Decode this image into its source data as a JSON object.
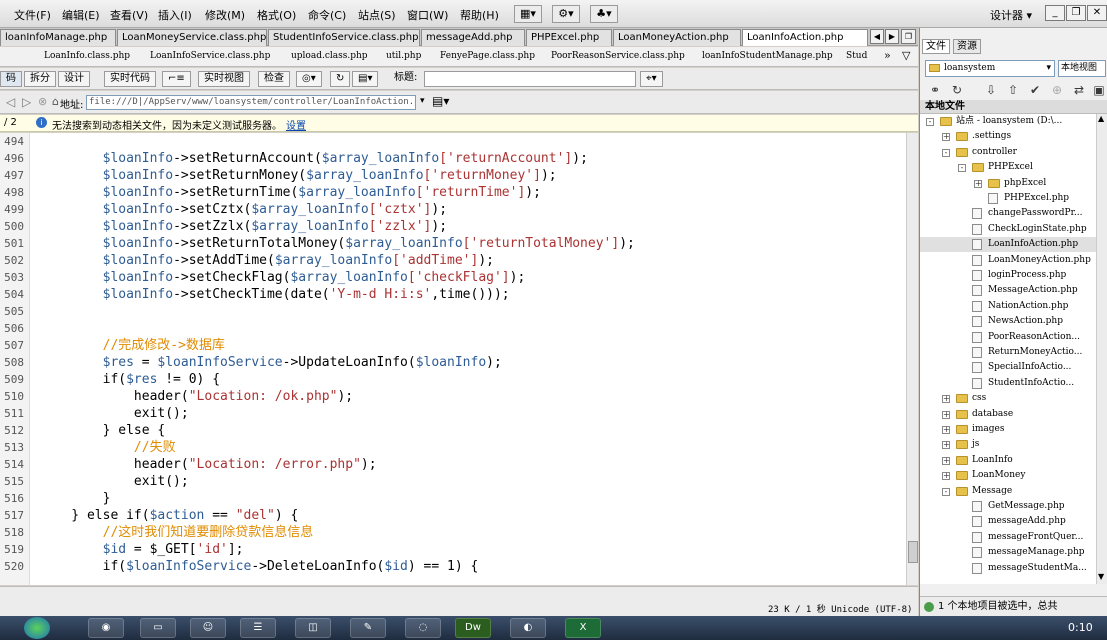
{
  "menus": [
    "文件(F)",
    "编辑(E)",
    "查看(V)",
    "插入(I)",
    "修改(M)",
    "格式(O)",
    "命令(C)",
    "站点(S)",
    "窗口(W)",
    "帮助(H)"
  ],
  "workspace": "设计器",
  "file_tabs": [
    {
      "label": "loanInfoManage.php"
    },
    {
      "label": "LoanMoneyService.class.php"
    },
    {
      "label": "StudentInfoService.class.php"
    },
    {
      "label": "messageAdd.php"
    },
    {
      "label": "PHPExcel.php"
    },
    {
      "label": "LoanMoneyAction.php"
    },
    {
      "label": "LoanInfoAction.php"
    }
  ],
  "related_files": [
    "LoanInfo.class.php",
    "LoanInfoService.class.php",
    "upload.class.php",
    "util.php",
    "FenyePage.class.php",
    "PoorReasonService.class.php",
    "loanInfoStudentManage.php",
    "Stud"
  ],
  "doc_toolbar": {
    "code": "码",
    "split": "拆分",
    "design": "设计",
    "live_code": "实时代码",
    "live_view": "实时视图",
    "inspect": "检查",
    "title_label": "标题:"
  },
  "address": {
    "label": "地址:",
    "value": "file:///D|/AppServ/www/loansystem/controller/LoanInfoAction.php"
  },
  "infobar": {
    "page": "/ 2",
    "message": "无法搜索到动态相关文件，因为未定义测试服务器。",
    "link": "设置"
  },
  "code_lines": [
    {
      "n": "494",
      "t": [
        {
          "c": "",
          "s": ""
        }
      ]
    },
    {
      "n": "496",
      "t": [
        {
          "c": "v",
          "s": "        $loanInfo"
        },
        {
          "c": "",
          "s": "->setReturnAccount("
        },
        {
          "c": "v",
          "s": "$array_loanInfo"
        },
        {
          "c": "s",
          "s": "['returnAccount']"
        },
        {
          "c": "",
          "s": ");"
        }
      ]
    },
    {
      "n": "497",
      "t": [
        {
          "c": "v",
          "s": "        $loanInfo"
        },
        {
          "c": "",
          "s": "->setReturnMoney("
        },
        {
          "c": "v",
          "s": "$array_loanInfo"
        },
        {
          "c": "s",
          "s": "['returnMoney']"
        },
        {
          "c": "",
          "s": ");"
        }
      ]
    },
    {
      "n": "498",
      "t": [
        {
          "c": "v",
          "s": "        $loanInfo"
        },
        {
          "c": "",
          "s": "->setReturnTime("
        },
        {
          "c": "v",
          "s": "$array_loanInfo"
        },
        {
          "c": "s",
          "s": "['returnTime']"
        },
        {
          "c": "",
          "s": ");"
        }
      ]
    },
    {
      "n": "499",
      "t": [
        {
          "c": "v",
          "s": "        $loanInfo"
        },
        {
          "c": "",
          "s": "->setCztx("
        },
        {
          "c": "v",
          "s": "$array_loanInfo"
        },
        {
          "c": "s",
          "s": "['cztx']"
        },
        {
          "c": "",
          "s": ");"
        }
      ]
    },
    {
      "n": "500",
      "t": [
        {
          "c": "v",
          "s": "        $loanInfo"
        },
        {
          "c": "",
          "s": "->setZzlx("
        },
        {
          "c": "v",
          "s": "$array_loanInfo"
        },
        {
          "c": "s",
          "s": "['zzlx']"
        },
        {
          "c": "",
          "s": ");"
        }
      ]
    },
    {
      "n": "501",
      "t": [
        {
          "c": "v",
          "s": "        $loanInfo"
        },
        {
          "c": "",
          "s": "->setReturnTotalMoney("
        },
        {
          "c": "v",
          "s": "$array_loanInfo"
        },
        {
          "c": "s",
          "s": "['returnTotalMoney']"
        },
        {
          "c": "",
          "s": ");"
        }
      ]
    },
    {
      "n": "502",
      "t": [
        {
          "c": "v",
          "s": "        $loanInfo"
        },
        {
          "c": "",
          "s": "->setAddTime("
        },
        {
          "c": "v",
          "s": "$array_loanInfo"
        },
        {
          "c": "s",
          "s": "['addTime']"
        },
        {
          "c": "",
          "s": ");"
        }
      ]
    },
    {
      "n": "503",
      "t": [
        {
          "c": "v",
          "s": "        $loanInfo"
        },
        {
          "c": "",
          "s": "->setCheckFlag("
        },
        {
          "c": "v",
          "s": "$array_loanInfo"
        },
        {
          "c": "s",
          "s": "['checkFlag']"
        },
        {
          "c": "",
          "s": ");"
        }
      ]
    },
    {
      "n": "504",
      "t": [
        {
          "c": "v",
          "s": "        $loanInfo"
        },
        {
          "c": "",
          "s": "->setCheckTime(date("
        },
        {
          "c": "s",
          "s": "'Y-m-d H:i:s'"
        },
        {
          "c": "",
          "s": ",time()));"
        }
      ]
    },
    {
      "n": "505",
      "t": [
        {
          "c": "",
          "s": ""
        }
      ]
    },
    {
      "n": "506",
      "t": [
        {
          "c": "",
          "s": ""
        }
      ]
    },
    {
      "n": "507",
      "t": [
        {
          "c": "m",
          "s": "        //完成修改->数据库"
        }
      ]
    },
    {
      "n": "508",
      "t": [
        {
          "c": "v",
          "s": "        $res"
        },
        {
          "c": "",
          "s": " = "
        },
        {
          "c": "v",
          "s": "$loanInfoService"
        },
        {
          "c": "",
          "s": "->UpdateLoanInfo("
        },
        {
          "c": "v",
          "s": "$loanInfo"
        },
        {
          "c": "",
          "s": ");"
        }
      ]
    },
    {
      "n": "509",
      "t": [
        {
          "c": "",
          "s": "        if("
        },
        {
          "c": "v",
          "s": "$res"
        },
        {
          "c": "",
          "s": " != 0) {"
        }
      ]
    },
    {
      "n": "510",
      "t": [
        {
          "c": "",
          "s": "            header("
        },
        {
          "c": "s",
          "s": "\"Location: /ok.php\""
        },
        {
          "c": "",
          "s": ");"
        }
      ]
    },
    {
      "n": "511",
      "t": [
        {
          "c": "",
          "s": "            exit();"
        }
      ]
    },
    {
      "n": "512",
      "t": [
        {
          "c": "",
          "s": "        } else {"
        }
      ]
    },
    {
      "n": "513",
      "t": [
        {
          "c": "m",
          "s": "            //失败"
        }
      ]
    },
    {
      "n": "514",
      "t": [
        {
          "c": "",
          "s": "            header("
        },
        {
          "c": "s",
          "s": "\"Location: /error.php\""
        },
        {
          "c": "",
          "s": ");"
        }
      ]
    },
    {
      "n": "515",
      "t": [
        {
          "c": "",
          "s": "            exit();"
        }
      ]
    },
    {
      "n": "516",
      "t": [
        {
          "c": "",
          "s": "        }"
        }
      ]
    },
    {
      "n": "517",
      "t": [
        {
          "c": "",
          "s": "    } else if("
        },
        {
          "c": "v",
          "s": "$action"
        },
        {
          "c": "",
          "s": " == "
        },
        {
          "c": "s",
          "s": "\"del\""
        },
        {
          "c": "",
          "s": ") {"
        }
      ]
    },
    {
      "n": "518",
      "t": [
        {
          "c": "m",
          "s": "        //这时我们知道要删除贷款信息信息"
        }
      ]
    },
    {
      "n": "519",
      "t": [
        {
          "c": "v",
          "s": "        $id"
        },
        {
          "c": "",
          "s": " = $_GET["
        },
        {
          "c": "s",
          "s": "'id'"
        },
        {
          "c": "",
          "s": "];"
        }
      ]
    },
    {
      "n": "520",
      "t": [
        {
          "c": "",
          "s": "        if("
        },
        {
          "c": "v",
          "s": "$loanInfoService"
        },
        {
          "c": "",
          "s": "->DeleteLoanInfo("
        },
        {
          "c": "v",
          "s": "$id"
        },
        {
          "c": "",
          "s": ") == 1) {"
        }
      ]
    }
  ],
  "status": "23 K / 1 秒  Unicode (UTF-8)",
  "panel": {
    "tab_files": "文件",
    "tab_assets": "资源",
    "site": "loansystem",
    "view": "本地视图",
    "local_files": "本地文件",
    "status": "1 个本地项目被选中，总共"
  },
  "tree": [
    {
      "label": "站点 - loansystem (D:\\...",
      "depth": 0,
      "kind": "folder",
      "exp": "-"
    },
    {
      "label": ".settings",
      "depth": 1,
      "kind": "folder",
      "exp": "+"
    },
    {
      "label": "controller",
      "depth": 1,
      "kind": "folder",
      "exp": "-"
    },
    {
      "label": "PHPExcel",
      "depth": 2,
      "kind": "folder",
      "exp": "-"
    },
    {
      "label": "phpExcel",
      "depth": 3,
      "kind": "folder",
      "exp": "+"
    },
    {
      "label": "PHPExcel.php",
      "depth": 3,
      "kind": "php",
      "exp": ""
    },
    {
      "label": "changePasswordPr...",
      "depth": 2,
      "kind": "php",
      "exp": ""
    },
    {
      "label": "CheckLoginState.php",
      "depth": 2,
      "kind": "php",
      "exp": ""
    },
    {
      "label": "LoanInfoAction.php",
      "depth": 2,
      "kind": "php",
      "exp": "",
      "selected": true
    },
    {
      "label": "LoanMoneyAction.php",
      "depth": 2,
      "kind": "php",
      "exp": ""
    },
    {
      "label": "loginProcess.php",
      "depth": 2,
      "kind": "php",
      "exp": ""
    },
    {
      "label": "MessageAction.php",
      "depth": 2,
      "kind": "php",
      "exp": ""
    },
    {
      "label": "NationAction.php",
      "depth": 2,
      "kind": "php",
      "exp": ""
    },
    {
      "label": "NewsAction.php",
      "depth": 2,
      "kind": "php",
      "exp": ""
    },
    {
      "label": "PoorReasonAction...",
      "depth": 2,
      "kind": "php",
      "exp": ""
    },
    {
      "label": "ReturnMoneyActio...",
      "depth": 2,
      "kind": "php",
      "exp": ""
    },
    {
      "label": "SpecialInfoActio...",
      "depth": 2,
      "kind": "php",
      "exp": ""
    },
    {
      "label": "StudentInfoActio...",
      "depth": 2,
      "kind": "php",
      "exp": ""
    },
    {
      "label": "css",
      "depth": 1,
      "kind": "folder",
      "exp": "+"
    },
    {
      "label": "database",
      "depth": 1,
      "kind": "folder",
      "exp": "+"
    },
    {
      "label": "images",
      "depth": 1,
      "kind": "folder",
      "exp": "+"
    },
    {
      "label": "js",
      "depth": 1,
      "kind": "folder",
      "exp": "+"
    },
    {
      "label": "LoanInfo",
      "depth": 1,
      "kind": "folder",
      "exp": "+"
    },
    {
      "label": "LoanMoney",
      "depth": 1,
      "kind": "folder",
      "exp": "+"
    },
    {
      "label": "Message",
      "depth": 1,
      "kind": "folder",
      "exp": "-"
    },
    {
      "label": "GetMessage.php",
      "depth": 2,
      "kind": "php",
      "exp": ""
    },
    {
      "label": "messageAdd.php",
      "depth": 2,
      "kind": "php",
      "exp": ""
    },
    {
      "label": "messageFrontQuer...",
      "depth": 2,
      "kind": "php",
      "exp": ""
    },
    {
      "label": "messageManage.php",
      "depth": 2,
      "kind": "php",
      "exp": ""
    },
    {
      "label": "messageStudentMa...",
      "depth": 2,
      "kind": "php",
      "exp": ""
    }
  ],
  "clock": "0:10"
}
